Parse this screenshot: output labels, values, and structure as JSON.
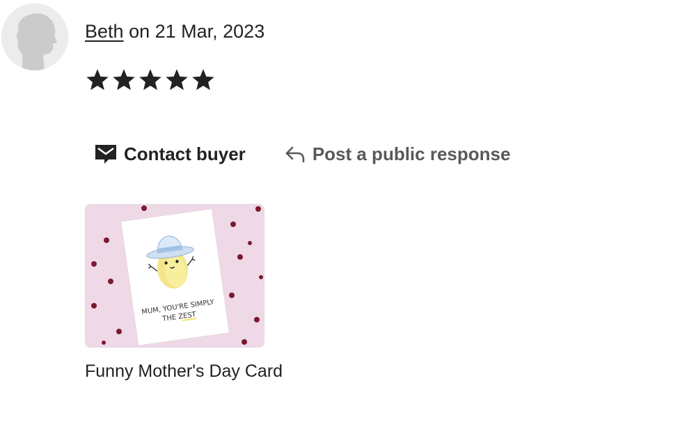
{
  "review": {
    "reviewer_name": "Beth",
    "date_text": "on 21 Mar, 2023",
    "rating": 5,
    "rating_max": 5
  },
  "actions": {
    "contact_label": "Contact buyer",
    "respond_label": "Post a public response"
  },
  "product": {
    "title": "Funny Mother's Day Card",
    "card_text_line1": "MUM, YOU'RE SIMPLY",
    "card_text_line2": "THE ZEST"
  },
  "colors": {
    "text": "#222222",
    "secondary_text": "#595959",
    "avatar_bg": "#ececec",
    "star": "#222222",
    "thumb_bg": "#efd9e7",
    "heart": "#7a1a2e"
  },
  "icons": {
    "contact": "envelope-message-icon",
    "respond": "reply-arrow-icon",
    "rating": "star-icon",
    "avatar": "person-silhouette-icon"
  }
}
